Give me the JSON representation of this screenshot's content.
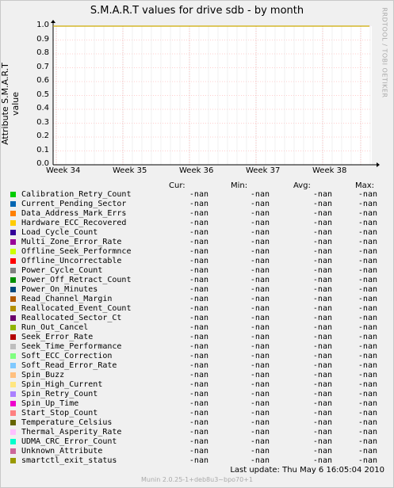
{
  "chart_data": {
    "type": "line",
    "title": "S.M.A.R.T values for drive sdb - by month",
    "ylabel": "Attribute S.M.A.R.T value",
    "xlabel": "",
    "ylim": [
      0.0,
      1.0
    ],
    "yticks": [
      "0.0",
      "0.1",
      "0.2",
      "0.3",
      "0.4",
      "0.5",
      "0.6",
      "0.7",
      "0.8",
      "0.9",
      "1.0"
    ],
    "xticks": [
      "Week 34",
      "Week 35",
      "Week 36",
      "Week 37",
      "Week 38"
    ],
    "grid": true,
    "series_line_color": "#ccaa00",
    "series_line_value": 1.0
  },
  "watermark": "RRDTOOL / TOBI OETIKER",
  "legend_header": {
    "cur": "Cur:",
    "min": "Min:",
    "avg": "Avg:",
    "max": "Max:"
  },
  "legend": [
    {
      "name": "Calibration_Retry_Count",
      "color": "#00cc00",
      "cur": "-nan",
      "min": "-nan",
      "avg": "-nan",
      "max": "-nan"
    },
    {
      "name": "Current_Pending_Sector",
      "color": "#0066b3",
      "cur": "-nan",
      "min": "-nan",
      "avg": "-nan",
      "max": "-nan"
    },
    {
      "name": "Data_Address_Mark_Errs",
      "color": "#ff8000",
      "cur": "-nan",
      "min": "-nan",
      "avg": "-nan",
      "max": "-nan"
    },
    {
      "name": "Hardware_ECC_Recovered",
      "color": "#ffcc00",
      "cur": "-nan",
      "min": "-nan",
      "avg": "-nan",
      "max": "-nan"
    },
    {
      "name": "Load_Cycle_Count",
      "color": "#330099",
      "cur": "-nan",
      "min": "-nan",
      "avg": "-nan",
      "max": "-nan"
    },
    {
      "name": "Multi_Zone_Error_Rate",
      "color": "#990099",
      "cur": "-nan",
      "min": "-nan",
      "avg": "-nan",
      "max": "-nan"
    },
    {
      "name": "Offline_Seek_Performnce",
      "color": "#ccff00",
      "cur": "-nan",
      "min": "-nan",
      "avg": "-nan",
      "max": "-nan"
    },
    {
      "name": "Offline_Uncorrectable",
      "color": "#ff0000",
      "cur": "-nan",
      "min": "-nan",
      "avg": "-nan",
      "max": "-nan"
    },
    {
      "name": "Power_Cycle_Count",
      "color": "#808080",
      "cur": "-nan",
      "min": "-nan",
      "avg": "-nan",
      "max": "-nan"
    },
    {
      "name": "Power_Off_Retract_Count",
      "color": "#008f00",
      "cur": "-nan",
      "min": "-nan",
      "avg": "-nan",
      "max": "-nan"
    },
    {
      "name": "Power_On_Minutes",
      "color": "#00487d",
      "cur": "-nan",
      "min": "-nan",
      "avg": "-nan",
      "max": "-nan"
    },
    {
      "name": "Read_Channel_Margin",
      "color": "#b35a00",
      "cur": "-nan",
      "min": "-nan",
      "avg": "-nan",
      "max": "-nan"
    },
    {
      "name": "Reallocated_Event_Count",
      "color": "#b38f00",
      "cur": "-nan",
      "min": "-nan",
      "avg": "-nan",
      "max": "-nan"
    },
    {
      "name": "Reallocated_Sector_Ct",
      "color": "#6b006b",
      "cur": "-nan",
      "min": "-nan",
      "avg": "-nan",
      "max": "-nan"
    },
    {
      "name": "Run_Out_Cancel",
      "color": "#8fb300",
      "cur": "-nan",
      "min": "-nan",
      "avg": "-nan",
      "max": "-nan"
    },
    {
      "name": "Seek_Error_Rate",
      "color": "#b30000",
      "cur": "-nan",
      "min": "-nan",
      "avg": "-nan",
      "max": "-nan"
    },
    {
      "name": "Seek_Time_Performance",
      "color": "#bebebe",
      "cur": "-nan",
      "min": "-nan",
      "avg": "-nan",
      "max": "-nan"
    },
    {
      "name": "Soft_ECC_Correction",
      "color": "#80ff80",
      "cur": "-nan",
      "min": "-nan",
      "avg": "-nan",
      "max": "-nan"
    },
    {
      "name": "Soft_Read_Error_Rate",
      "color": "#80c9ff",
      "cur": "-nan",
      "min": "-nan",
      "avg": "-nan",
      "max": "-nan"
    },
    {
      "name": "Spin_Buzz",
      "color": "#ffc080",
      "cur": "-nan",
      "min": "-nan",
      "avg": "-nan",
      "max": "-nan"
    },
    {
      "name": "Spin_High_Current",
      "color": "#ffe680",
      "cur": "-nan",
      "min": "-nan",
      "avg": "-nan",
      "max": "-nan"
    },
    {
      "name": "Spin_Retry_Count",
      "color": "#aa80ff",
      "cur": "-nan",
      "min": "-nan",
      "avg": "-nan",
      "max": "-nan"
    },
    {
      "name": "Spin_Up_Time",
      "color": "#ee00cc",
      "cur": "-nan",
      "min": "-nan",
      "avg": "-nan",
      "max": "-nan"
    },
    {
      "name": "Start_Stop_Count",
      "color": "#ff8080",
      "cur": "-nan",
      "min": "-nan",
      "avg": "-nan",
      "max": "-nan"
    },
    {
      "name": "Temperature_Celsius",
      "color": "#666600",
      "cur": "-nan",
      "min": "-nan",
      "avg": "-nan",
      "max": "-nan"
    },
    {
      "name": "Thermal_Asperity_Rate",
      "color": "#ffbfff",
      "cur": "-nan",
      "min": "-nan",
      "avg": "-nan",
      "max": "-nan"
    },
    {
      "name": "UDMA_CRC_Error_Count",
      "color": "#00ffcc",
      "cur": "-nan",
      "min": "-nan",
      "avg": "-nan",
      "max": "-nan"
    },
    {
      "name": "Unknown_Attribute",
      "color": "#cc6699",
      "cur": "-nan",
      "min": "-nan",
      "avg": "-nan",
      "max": "-nan"
    },
    {
      "name": "smartctl_exit_status",
      "color": "#999900",
      "cur": "-nan",
      "min": "-nan",
      "avg": "-nan",
      "max": "-nan"
    }
  ],
  "last_update": "Last update:  Thu May  6 16:05:04 2010",
  "footer": "Munin 2.0.25-1+deb8u3~bpo70+1"
}
